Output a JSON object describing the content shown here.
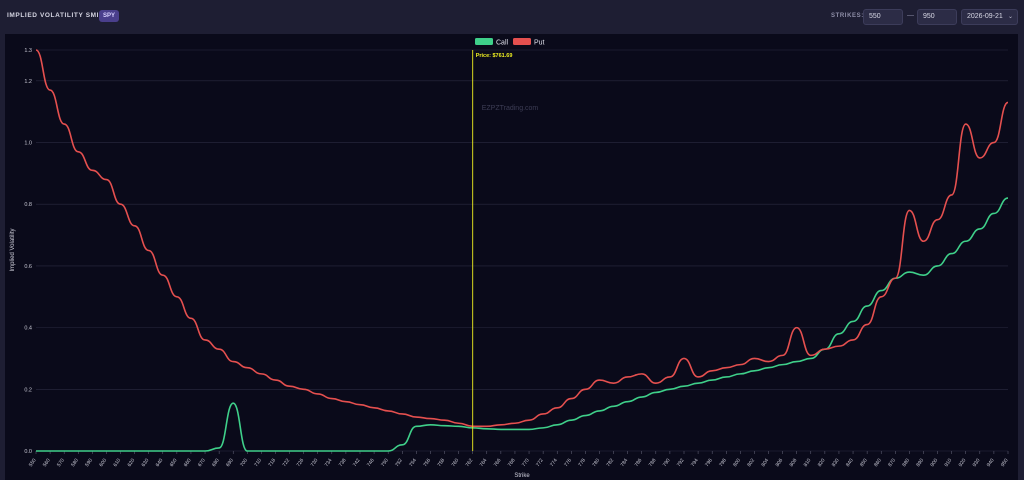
{
  "header": {
    "title": "IMPLIED VOLATILITY SMILE",
    "ticker": "SPY",
    "strikes_label": "STRIKES:",
    "strike_min": "550",
    "dash": "—",
    "strike_max": "950",
    "expiry": "2026-09-21",
    "expiry_chevron": "chevron-down-icon"
  },
  "colors": {
    "call": "#3fd08a",
    "put": "#e5504f",
    "price_line": "#f0f020",
    "grid": "#2a2a40",
    "accent": "#4a3f8c"
  },
  "chart_data": {
    "type": "line",
    "title": "",
    "xlabel": "Strike",
    "ylabel": "Implied Volatility",
    "ylim": [
      0,
      1.3
    ],
    "yticks": [
      0,
      0.2,
      0.4,
      0.6,
      0.8,
      1.0,
      1.2,
      1.3
    ],
    "ytick_labels": [
      "0.0",
      "0.2",
      "0.4",
      "0.6",
      "0.8",
      "1.0",
      "1.2",
      "1.3"
    ],
    "grid": true,
    "legend": "top-center",
    "watermark": "EZPZTrading.com",
    "price_marker": {
      "label": "Price: $761.69",
      "strike": "762"
    },
    "categories": [
      "550",
      "560",
      "570",
      "580",
      "590",
      "600",
      "610",
      "620",
      "630",
      "640",
      "650",
      "660",
      "670",
      "680",
      "690",
      "700",
      "710",
      "718",
      "722",
      "726",
      "730",
      "734",
      "738",
      "742",
      "746",
      "750",
      "752",
      "754",
      "756",
      "758",
      "760",
      "762",
      "764",
      "766",
      "768",
      "770",
      "772",
      "774",
      "776",
      "778",
      "780",
      "782",
      "784",
      "786",
      "788",
      "790",
      "792",
      "794",
      "796",
      "798",
      "800",
      "802",
      "804",
      "806",
      "808",
      "810",
      "820",
      "830",
      "840",
      "850",
      "860",
      "870",
      "880",
      "890",
      "900",
      "910",
      "920",
      "930",
      "940",
      "950"
    ],
    "series": [
      {
        "name": "Call",
        "values": [
          0,
          0,
          0,
          0,
          0,
          0,
          0,
          0,
          0,
          0,
          0,
          0,
          0,
          0.01,
          0.155,
          0,
          0,
          0,
          0,
          0,
          0,
          0,
          0,
          0,
          0,
          0,
          0.02,
          0.08,
          0.085,
          0.082,
          0.08,
          0.075,
          0.072,
          0.07,
          0.07,
          0.07,
          0.075,
          0.085,
          0.1,
          0.115,
          0.13,
          0.145,
          0.16,
          0.175,
          0.19,
          0.2,
          0.21,
          0.22,
          0.23,
          0.24,
          0.25,
          0.26,
          0.27,
          0.28,
          0.29,
          0.3,
          0.33,
          0.38,
          0.42,
          0.47,
          0.52,
          0.56,
          0.58,
          0.57,
          0.6,
          0.64,
          0.68,
          0.72,
          0.77,
          0.82
        ]
      },
      {
        "name": "Put",
        "values": [
          1.3,
          1.17,
          1.06,
          0.97,
          0.91,
          0.88,
          0.8,
          0.73,
          0.65,
          0.57,
          0.5,
          0.43,
          0.36,
          0.33,
          0.29,
          0.27,
          0.25,
          0.23,
          0.21,
          0.2,
          0.185,
          0.17,
          0.16,
          0.15,
          0.14,
          0.13,
          0.12,
          0.11,
          0.105,
          0.1,
          0.09,
          0.08,
          0.08,
          0.085,
          0.09,
          0.1,
          0.12,
          0.14,
          0.17,
          0.2,
          0.23,
          0.22,
          0.24,
          0.25,
          0.22,
          0.24,
          0.3,
          0.24,
          0.26,
          0.27,
          0.28,
          0.3,
          0.29,
          0.31,
          0.4,
          0.31,
          0.33,
          0.34,
          0.36,
          0.41,
          0.5,
          0.56,
          0.78,
          0.68,
          0.75,
          0.83,
          1.06,
          0.95,
          1.0,
          1.13
        ]
      }
    ]
  }
}
